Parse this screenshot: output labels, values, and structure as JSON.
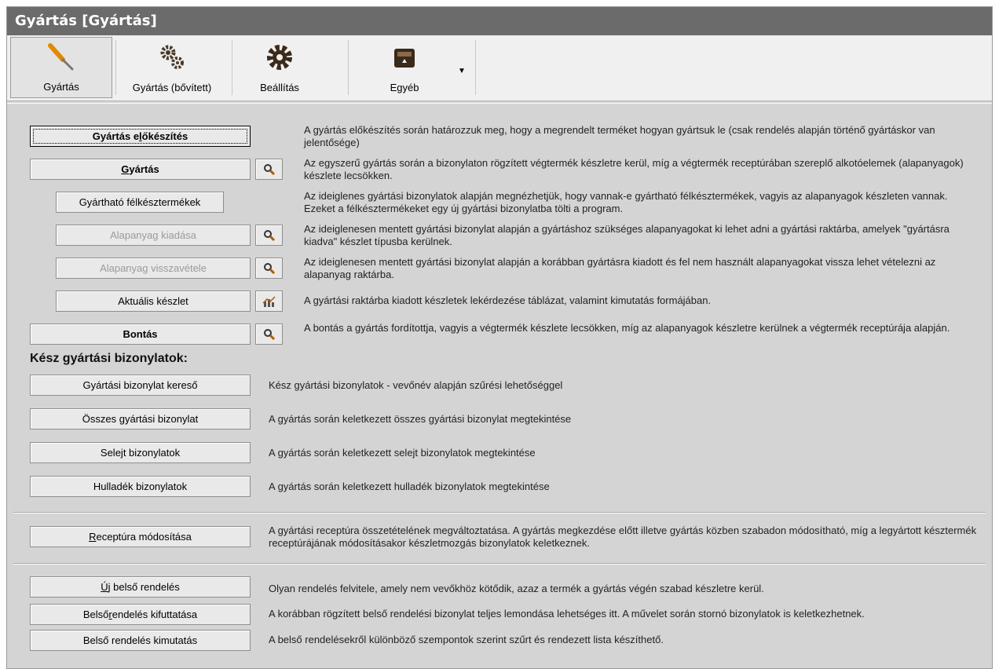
{
  "window": {
    "title": "Gyártás [Gyártás]"
  },
  "toolbar": {
    "items": [
      {
        "label": "Gyártás",
        "icon": "screwdriver-icon"
      },
      {
        "label": "Gyártás (bővített)",
        "icon": "gears-icon"
      },
      {
        "label": "Beállítás",
        "icon": "gear-icon"
      },
      {
        "label": "Egyéb",
        "icon": "package-icon"
      }
    ],
    "dropdown_icon": "dropdown-arrow-icon"
  },
  "production": {
    "items": [
      {
        "label_pre": "Gyártás e",
        "label_u": "l",
        "label_post": "őkészítés",
        "desc": "A gyártás előkészítés során határozzuk meg, hogy a megrendelt terméket hogyan gyártsuk le (csak rendelés alapján történő gyártáskor van jelentősége)"
      },
      {
        "label_pre": "",
        "label_u": "G",
        "label_post": "yártás",
        "desc": "Az egyszerű gyártás során a bizonylaton rögzített végtermék készletre kerül, míg a végtermék receptúrában szereplő alkotóelemek (alapanyagok) készlete lecsökken."
      },
      {
        "label": "Gyártható félkésztermékek",
        "desc": "Az ideiglenes gyártási bizonylatok alapján megnézhetjük, hogy vannak-e gyártható félkésztermékek, vagyis az alapanyagok készleten vannak. Ezeket a félkésztermékeket egy új gyártási bizonylatba tölti a program."
      },
      {
        "label": "Alapanyag kiadása",
        "desc": "Az ideiglenesen mentett gyártási bizonylat alapján a gyártáshoz szükséges alapanyagokat ki lehet adni a gyártási raktárba, amelyek \"gyártásra kiadva\" készlet típusba kerülnek."
      },
      {
        "label": "Alapanyag visszavétele",
        "desc": "Az ideiglenesen mentett gyártási bizonylat alapján a korábban gyártásra kiadott és fel nem használt alapanyagokat vissza lehet vételezni az alapanyag raktárba."
      },
      {
        "label": "Aktuális készlet",
        "desc": "A gyártási raktárba kiadott készletek lekérdezése táblázat, valamint kimutatás formájában."
      },
      {
        "label": "Bontás",
        "desc": "A bontás a gyártás fordítottja, vagyis a végtermék készlete lecsökken, míg az alapanyagok készletre kerülnek a végtermék receptúrája alapján."
      }
    ]
  },
  "finished": {
    "title": "Kész gyártási bizonylatok:",
    "items": [
      {
        "label": "Gyártási bizonylat kereső",
        "desc": "Kész gyártási bizonylatok - vevőnév alapján szűrési lehetőséggel"
      },
      {
        "label": "Összes gyártási bizonylat",
        "desc": "A gyártás során keletkezett összes gyártási bizonylat megtekintése"
      },
      {
        "label": "Selejt bizonylatok",
        "desc": "A gyártás során keletkezett selejt bizonylatok megtekintése"
      },
      {
        "label": "Hulladék bizonylatok",
        "desc": "A gyártás során keletkezett hulladék bizonylatok megtekintése"
      }
    ]
  },
  "recipe": {
    "label_u": "R",
    "label_post": "eceptúra módosítása",
    "desc": "A gyártási receptúra összetételének megváltoztatása. A gyártás megkezdése előtt illetve gyártás közben szabadon módosítható, míg a legyártott késztermék receptúrájának módosításakor készletmozgás bizonylatok keletkeznek."
  },
  "internal": {
    "items": [
      {
        "label_u": "Ú",
        "label_post": "j belső rendelés",
        "desc": "Olyan rendelés felvitele, amely nem vevőkhöz kötődik, azaz a termék a gyártás végén szabad készletre kerül."
      },
      {
        "label_pre": "Belső ",
        "label_u": "r",
        "label_post": "endelés kifuttatása",
        "desc": "A korábban rögzített belső rendelési bizonylat teljes lemondása lehetséges itt. A művelet során stornó bizonylatok is keletkezhetnek."
      },
      {
        "label": "Belső rendelés kimutatás",
        "desc": "A belső rendelésekről különböző szempontok szerint szűrt és rendezett lista készíthető."
      }
    ]
  }
}
